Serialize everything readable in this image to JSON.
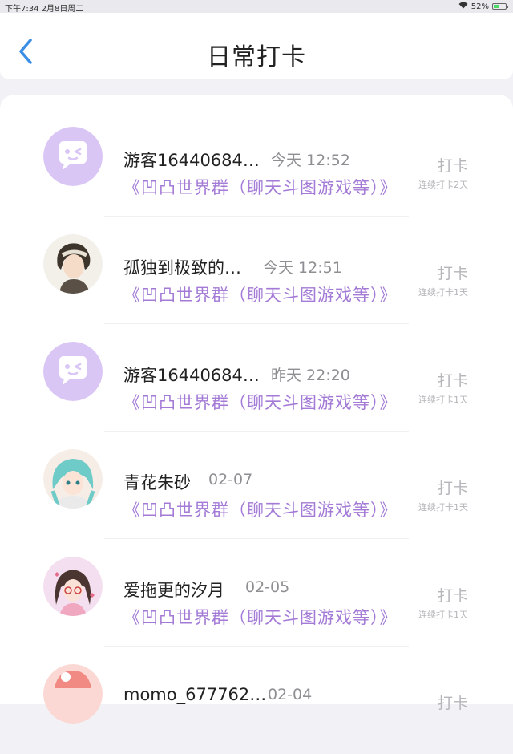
{
  "status_bar": {
    "time_date": "下午7:34   2月8日周二",
    "battery": "52%",
    "battery_level": 0.52
  },
  "header": {
    "title": "日常打卡",
    "back_icon": "chevron-left-icon"
  },
  "colors": {
    "accent": "#3a8ee6",
    "group_text": "#a37ad6",
    "avatar_bg": "#d9c6f5"
  },
  "entries": [
    {
      "name": "游客16440684…",
      "time": "今天 12:52",
      "group": "《凹凸世界群（聊天斗图游戏等）》",
      "action": "打卡",
      "streak": "连续打卡2天",
      "avatar": "guest-avatar"
    },
    {
      "name": "孤独到极致的…",
      "time": "今天 12:51",
      "group": "《凹凸世界群（聊天斗图游戏等）》",
      "action": "打卡",
      "streak": "连续打卡1天",
      "avatar": "anime-boy-avatar"
    },
    {
      "name": "游客16440684…",
      "time": "昨天 22:20",
      "group": "《凹凸世界群（聊天斗图游戏等）》",
      "action": "打卡",
      "streak": "连续打卡1天",
      "avatar": "guest-avatar"
    },
    {
      "name": "青花朱砂",
      "time": "02-07",
      "group": "《凹凸世界群（聊天斗图游戏等）》",
      "action": "打卡",
      "streak": "连续打卡1天",
      "avatar": "anime-girl-avatar"
    },
    {
      "name": "爱拖更的汐月",
      "time": "02-05",
      "group": "《凹凸世界群（聊天斗图游戏等）》",
      "action": "打卡",
      "streak": "连续打卡1天",
      "avatar": "girl-avatar"
    },
    {
      "name": "momo_677762…",
      "time": "02-04",
      "group": "",
      "action": "打卡",
      "streak": "",
      "avatar": "pink-avatar"
    }
  ]
}
